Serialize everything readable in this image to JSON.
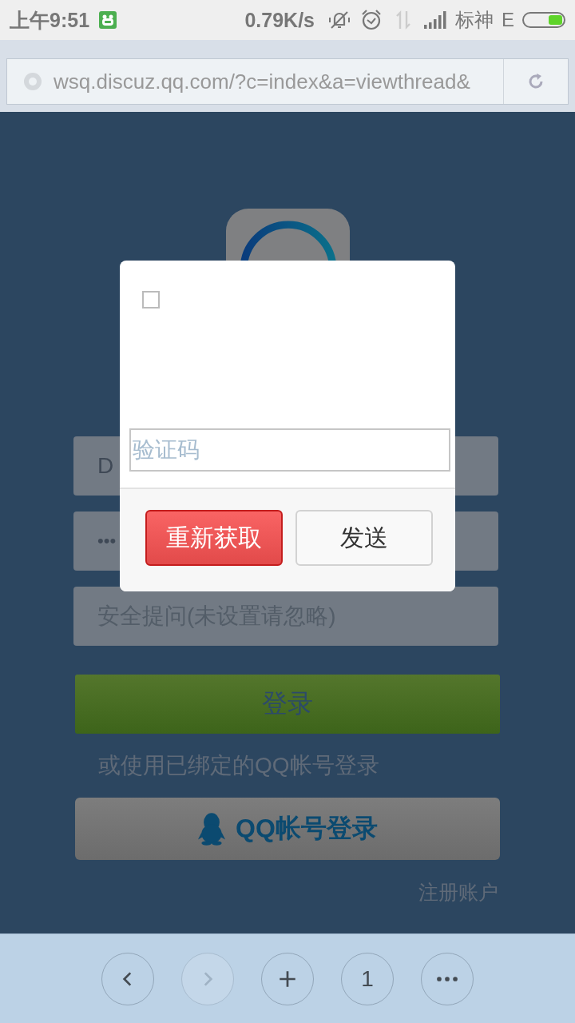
{
  "status_bar": {
    "time": "上午9:51",
    "speed": "0.79K/s",
    "carrier": "标神",
    "network": "E"
  },
  "address_bar": {
    "url": "wsq.discuz.qq.com/?c=index&a=viewthread&"
  },
  "login_form": {
    "username": {
      "value": "D"
    },
    "password": {
      "value": "•••"
    },
    "security_question": {
      "placeholder": "安全提问(未设置请忽略)"
    },
    "login_button": "登录",
    "alt_login_text": "或使用已绑定的QQ帐号登录",
    "qq_login_button": "QQ帐号登录",
    "register_link": "注册账户"
  },
  "dialog": {
    "checkbox": {
      "checked": false
    },
    "code_field": {
      "placeholder": "验证码"
    },
    "buttons": [
      {
        "label": "重新获取",
        "kind": "primary"
      },
      {
        "label": "发送",
        "kind": "default"
      }
    ]
  },
  "bottom_bar": {
    "buttons": [
      {
        "kind": "back",
        "disabled": false
      },
      {
        "kind": "forward",
        "disabled": true
      },
      {
        "kind": "new_tab",
        "disabled": false
      },
      {
        "kind": "tabs",
        "label": "1",
        "disabled": false
      },
      {
        "kind": "menu",
        "disabled": false
      }
    ]
  }
}
